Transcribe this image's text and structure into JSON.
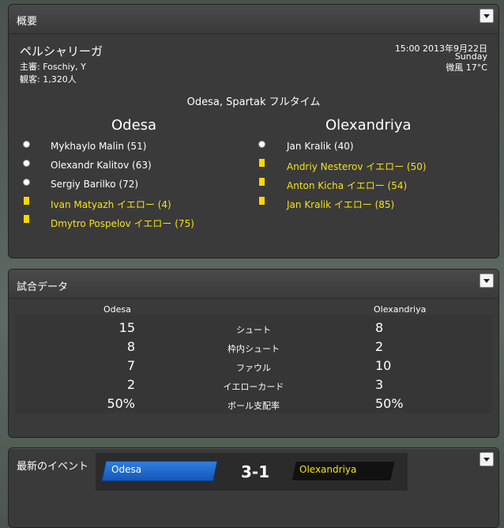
{
  "overview": {
    "title": "概要",
    "competition": "ペルシャリーガ",
    "referee": "主審: Foschiy, Y",
    "attendance": "観客: 1,320人",
    "datetime": "15:00 2013年9月22日",
    "weekday": "Sunday",
    "weather": "微風 17°C",
    "result_line": "Odesa, Spartak フルタイム",
    "home_team": "Odesa",
    "away_team": "Olexandriya",
    "home_events": [
      {
        "type": "goal",
        "text": "Mykhaylo Malin (51)"
      },
      {
        "type": "goal",
        "text": "Olexandr Kalitov (63)"
      },
      {
        "type": "goal",
        "text": "Sergiy Barilko (72)"
      },
      {
        "type": "yellow",
        "text": "Ivan Matyazh イエロー (4)"
      },
      {
        "type": "yellow",
        "text": "Dmytro Pospelov イエロー (75)"
      }
    ],
    "away_events": [
      {
        "type": "goal",
        "text": "Jan Kralik (40)"
      },
      {
        "type": "yellow",
        "text": "Andriy Nesterov イエロー (50)"
      },
      {
        "type": "yellow",
        "text": "Anton Kicha イエロー (54)"
      },
      {
        "type": "yellow",
        "text": "Jan Kralik イエロー (85)"
      }
    ]
  },
  "stats": {
    "title": "試合データ",
    "home_team": "Odesa",
    "away_team": "Olexandriya",
    "rows": [
      {
        "label": "シュート",
        "home": "15",
        "away": "8"
      },
      {
        "label": "枠内シュート",
        "home": "8",
        "away": "2"
      },
      {
        "label": "ファウル",
        "home": "7",
        "away": "10"
      },
      {
        "label": "イエローカード",
        "home": "2",
        "away": "3"
      },
      {
        "label": "ボール支配率",
        "home": "50%",
        "away": "50%"
      }
    ]
  },
  "latest": {
    "title": "最新のイベント",
    "home_team": "Odesa",
    "away_team": "Olexandriya",
    "score": "3-1"
  },
  "colors": {
    "event_yellow": "#f5e21b",
    "home_badge": "#1f6bd0",
    "away_badge": "#111111"
  },
  "icons": {
    "collapse": "chevron-down-icon",
    "goal": "ball-icon",
    "yellow": "yellow-card-icon"
  }
}
